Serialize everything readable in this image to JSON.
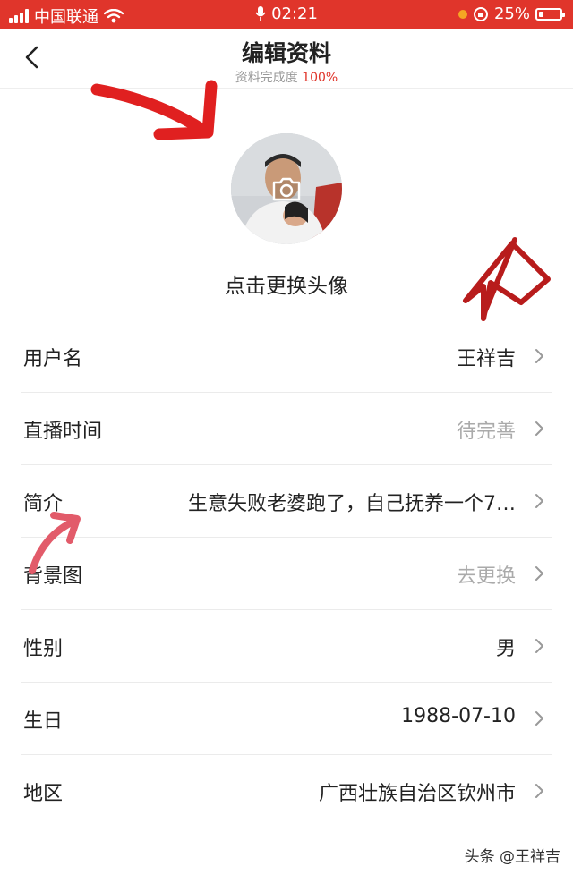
{
  "status_bar": {
    "carrier": "中国联通",
    "time": "02:21",
    "battery": "25%",
    "battery_level": 0.25,
    "icons": [
      "signal-icon",
      "wifi-icon",
      "mic-icon",
      "orientation-lock-icon",
      "battery-icon"
    ]
  },
  "header": {
    "title": "编辑资料",
    "subtitle_prefix": "资料完成度",
    "subtitle_value": "100%",
    "back_icon": "chevron-left-icon"
  },
  "avatar": {
    "label": "点击更换头像",
    "camera_icon": "camera-icon"
  },
  "rows": [
    {
      "label": "用户名",
      "value": "王祥吉",
      "muted": false
    },
    {
      "label": "直播时间",
      "value": "待完善",
      "muted": true
    },
    {
      "label": "简介",
      "value": "生意失败老婆跑了，自己抚养一个7…",
      "muted": false
    },
    {
      "label": "背景图",
      "value": "去更换",
      "muted": true
    },
    {
      "label": "性别",
      "value": "男",
      "muted": false
    },
    {
      "label": "生日",
      "value": "1988-07-10",
      "muted": false
    },
    {
      "label": "地区",
      "value": "广西壮族自治区钦州市",
      "muted": false
    }
  ],
  "watermark": "头条 @王祥吉",
  "colors": {
    "brand_red": "#e0352b",
    "muted_text": "#aaaaaa",
    "annotation_red": "#e02020"
  }
}
